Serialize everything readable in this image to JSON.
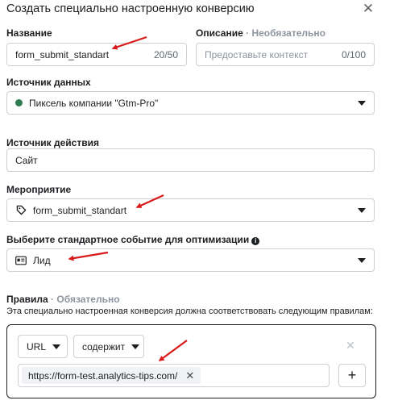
{
  "dialog": {
    "title": "Создать специально настроенную конверсию",
    "close_symbol": "✕"
  },
  "name_field": {
    "label": "Название",
    "value": "form_submit_standart",
    "counter": "20/50"
  },
  "description_field": {
    "label": "Описание",
    "label_suffix": "· Необязательно",
    "placeholder": "Предоставьте контекст",
    "counter": "0/100"
  },
  "data_source": {
    "label": "Источник данных",
    "value": "Пиксель компании \"Gtm-Pro\"",
    "status_color": "#2e7d4f"
  },
  "action_source": {
    "label": "Источник действия",
    "value": "Сайт"
  },
  "event": {
    "label": "Мероприятие",
    "value": "form_submit_standart",
    "icon": "tag-icon"
  },
  "standard_event": {
    "label": "Выберите стандартное событие для оптимизации",
    "info_symbol": "i",
    "value": "Лид",
    "icon": "id-card-icon"
  },
  "rules": {
    "label": "Правила",
    "label_suffix": "· Обязательно",
    "description": "Эта специально настроенная конверсия должна соответствовать следующим правилам:",
    "field_select": "URL",
    "operator_select": "содержит",
    "chip_value": "https://form-test.analytics-tips.com/",
    "chip_remove": "✕",
    "remove_rule": "✕",
    "add_button": "+"
  },
  "annotations": {
    "arrow_color": "#d91a1a"
  }
}
